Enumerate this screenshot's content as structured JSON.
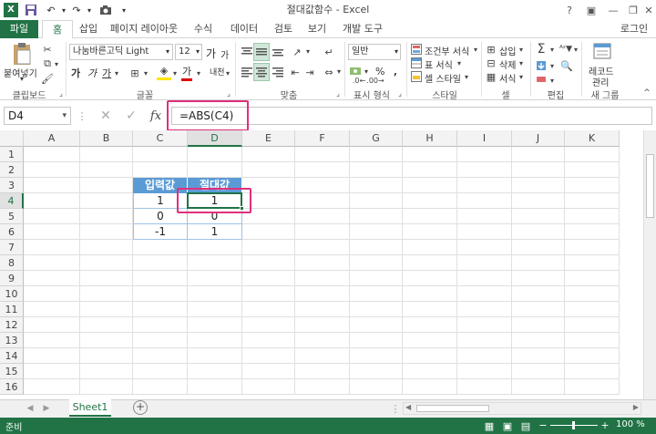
{
  "window": {
    "title": "절대값함수 - Excel",
    "sign_in": "로그인"
  },
  "tabs": [
    "파일",
    "홈",
    "삽입",
    "페이지 레이아웃",
    "수식",
    "데이터",
    "검토",
    "보기",
    "개발 도구"
  ],
  "ribbon": {
    "clipboard": {
      "paste": "붙여넣기",
      "label": "클립보드"
    },
    "font": {
      "name": "나눔바른고딕 Light",
      "size": "12",
      "bold": "가",
      "italic": "가",
      "underline": "가",
      "grow": "가",
      "shrink": "가",
      "fontcolor": "가",
      "phonetic": "내천",
      "label": "글꼴"
    },
    "alignment": {
      "label": "맞춤"
    },
    "number": {
      "format": "일반",
      "percent": "%",
      "label": "표시 형식"
    },
    "styles": {
      "conditional": "조건부 서식",
      "table": "표 서식",
      "cell": "셀 스타일",
      "label": "스타일"
    },
    "cells": {
      "insert": "삽입",
      "delete": "삭제",
      "format": "서식",
      "label": "셀"
    },
    "editing": {
      "label": "편집"
    },
    "newgroup": {
      "record1": "레코드",
      "record2": "관리",
      "label": "새 그룹"
    }
  },
  "formula_bar": {
    "name_box": "D4",
    "fx": "fx",
    "formula": "=ABS(C4)"
  },
  "columns": [
    "A",
    "B",
    "C",
    "D",
    "E",
    "F",
    "G",
    "H",
    "I",
    "J",
    "K"
  ],
  "rows": [
    "1",
    "2",
    "3",
    "4",
    "5",
    "6",
    "7",
    "8",
    "9",
    "10",
    "11",
    "12",
    "13",
    "14",
    "15",
    "16"
  ],
  "table": {
    "header": [
      "입력값",
      "절대값"
    ],
    "rows": [
      [
        "1",
        "1"
      ],
      [
        "0",
        "0"
      ],
      [
        "-1",
        "1"
      ]
    ]
  },
  "sheet": {
    "tab": "Sheet1",
    "add": "+"
  },
  "status": {
    "ready": "준비",
    "zoom": "100 %"
  },
  "colors": {
    "excel_green": "#217346",
    "header_blue": "#5b9bd5",
    "highlight": "#e0307b"
  }
}
